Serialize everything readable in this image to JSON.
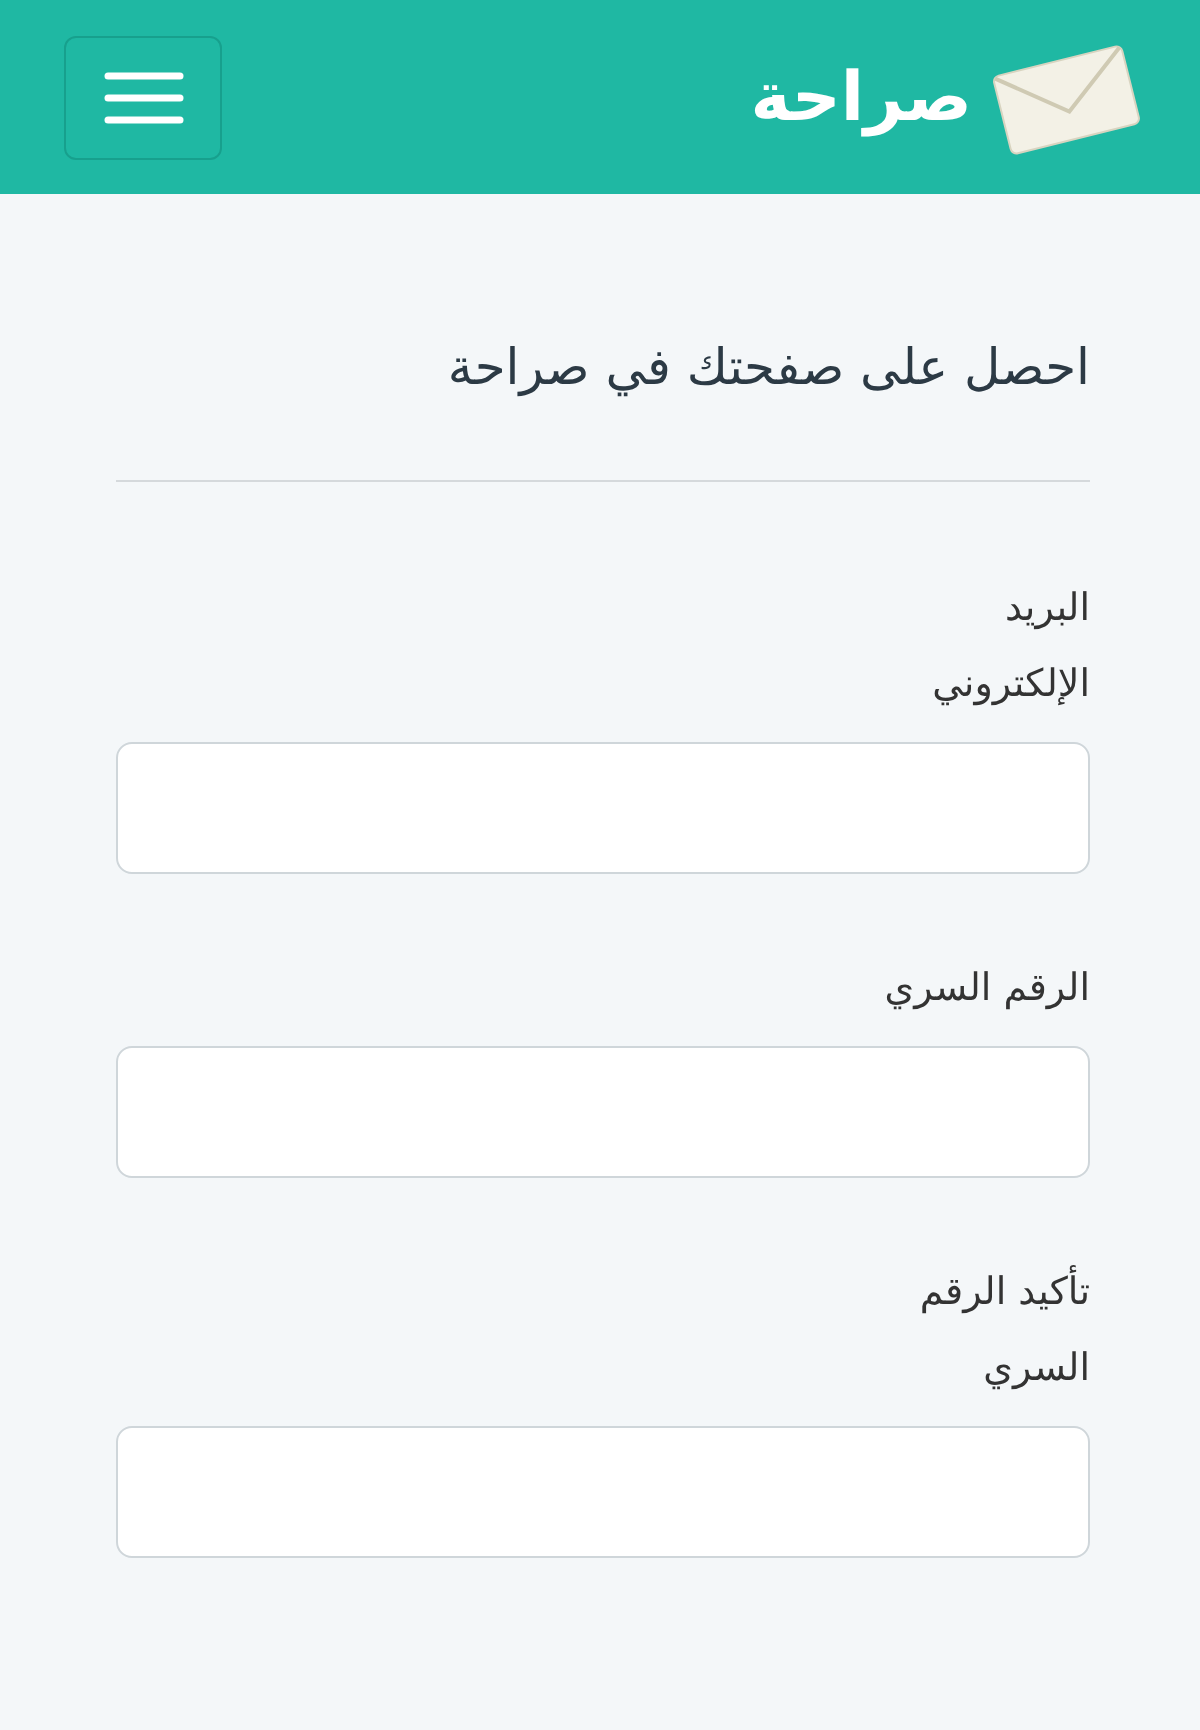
{
  "header": {
    "logo_text": "صراحة"
  },
  "form": {
    "title": "احصل على صفحتك في صراحة",
    "fields": [
      {
        "label": "البريد الإلكتروني"
      },
      {
        "label": "الرقم السري"
      },
      {
        "label": "تأكيد الرقم السري"
      }
    ]
  }
}
